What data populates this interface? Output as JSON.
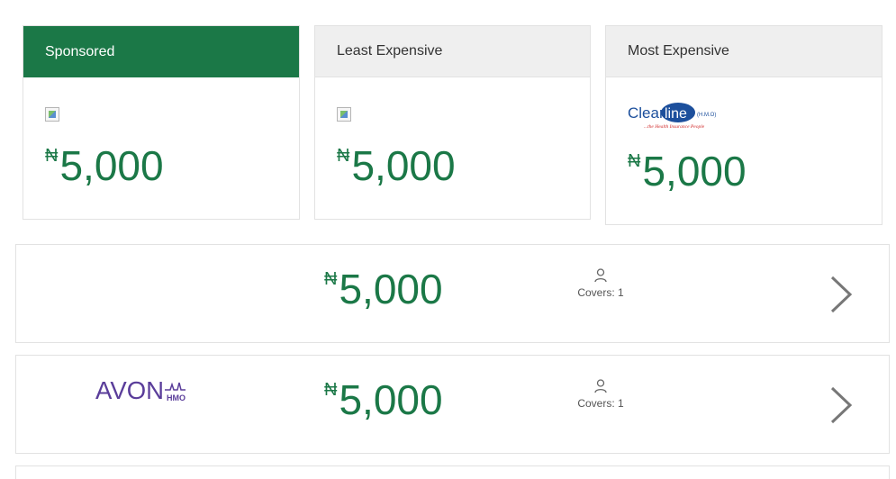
{
  "currency_symbol": "₦",
  "cards": [
    {
      "header": "Sponsored",
      "price": "5,000",
      "logo": "broken-image"
    },
    {
      "header": "Least Expensive",
      "price": "5,000",
      "logo": "broken-image"
    },
    {
      "header": "Most Expensive",
      "price": "5,000",
      "logo": "clearline-hmo-logo"
    }
  ],
  "logos": {
    "clearline": {
      "word1": "Clear",
      "word2": "line",
      "hmo": "(H.M.O)",
      "tagline": "...the Health Insurance People"
    },
    "avon": {
      "word": "AVON",
      "hmo": "HMO"
    }
  },
  "plans": [
    {
      "price": "5,000",
      "covers": "Covers: 1",
      "logo": "none"
    },
    {
      "price": "5,000",
      "covers": "Covers: 1",
      "logo": "avon-hmo-logo"
    }
  ],
  "colors": {
    "accent_green": "#1b7847",
    "header_gray": "#efefef",
    "border": "#e2e2e2",
    "avon_purple": "#5a3d9a",
    "clearline_blue": "#1c4f9c",
    "clearline_red": "#d02a2a"
  },
  "icons": {
    "person": "person-icon",
    "chevron": "chevron-right-icon"
  }
}
